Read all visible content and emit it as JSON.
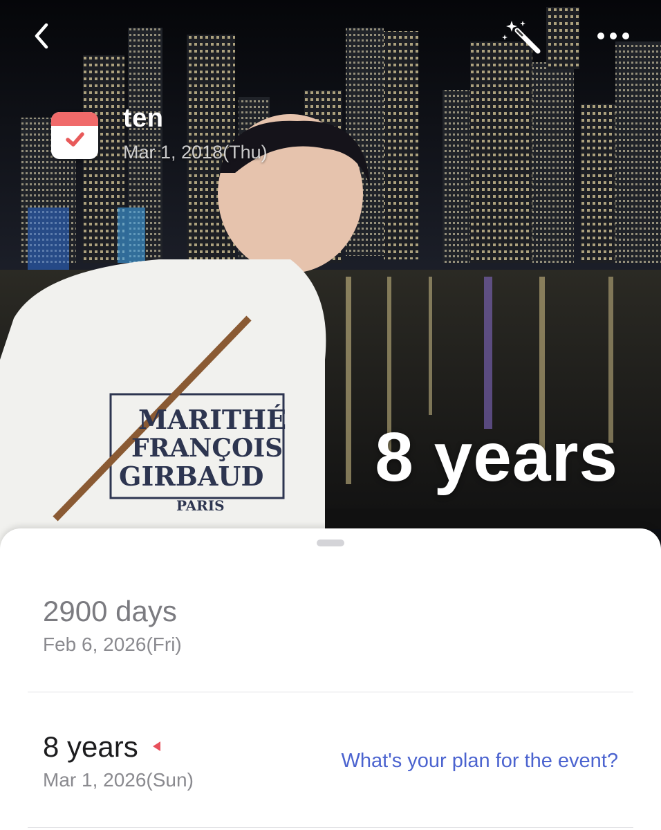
{
  "header": {
    "back_icon": "chevron-left-icon",
    "magic_icon": "magic-wand-icon",
    "more_icon": "more-dots-icon"
  },
  "event": {
    "icon": "calendar-check-icon",
    "title": "ten",
    "start_date": "Mar 1, 2018(Thu)",
    "elapsed": "8 years"
  },
  "milestones": [
    {
      "label": "2900 days",
      "date": "Feb 6, 2026(Fri)"
    },
    {
      "label": "8 years",
      "date": "Mar 1, 2026(Sun)",
      "marker_icon": "red-triangle-marker-icon",
      "action": "What's your plan for the event?"
    }
  ],
  "colors": {
    "accent_link": "#4b63cf",
    "calendar_red": "#f06a6a",
    "marker_red": "#e8505b"
  }
}
